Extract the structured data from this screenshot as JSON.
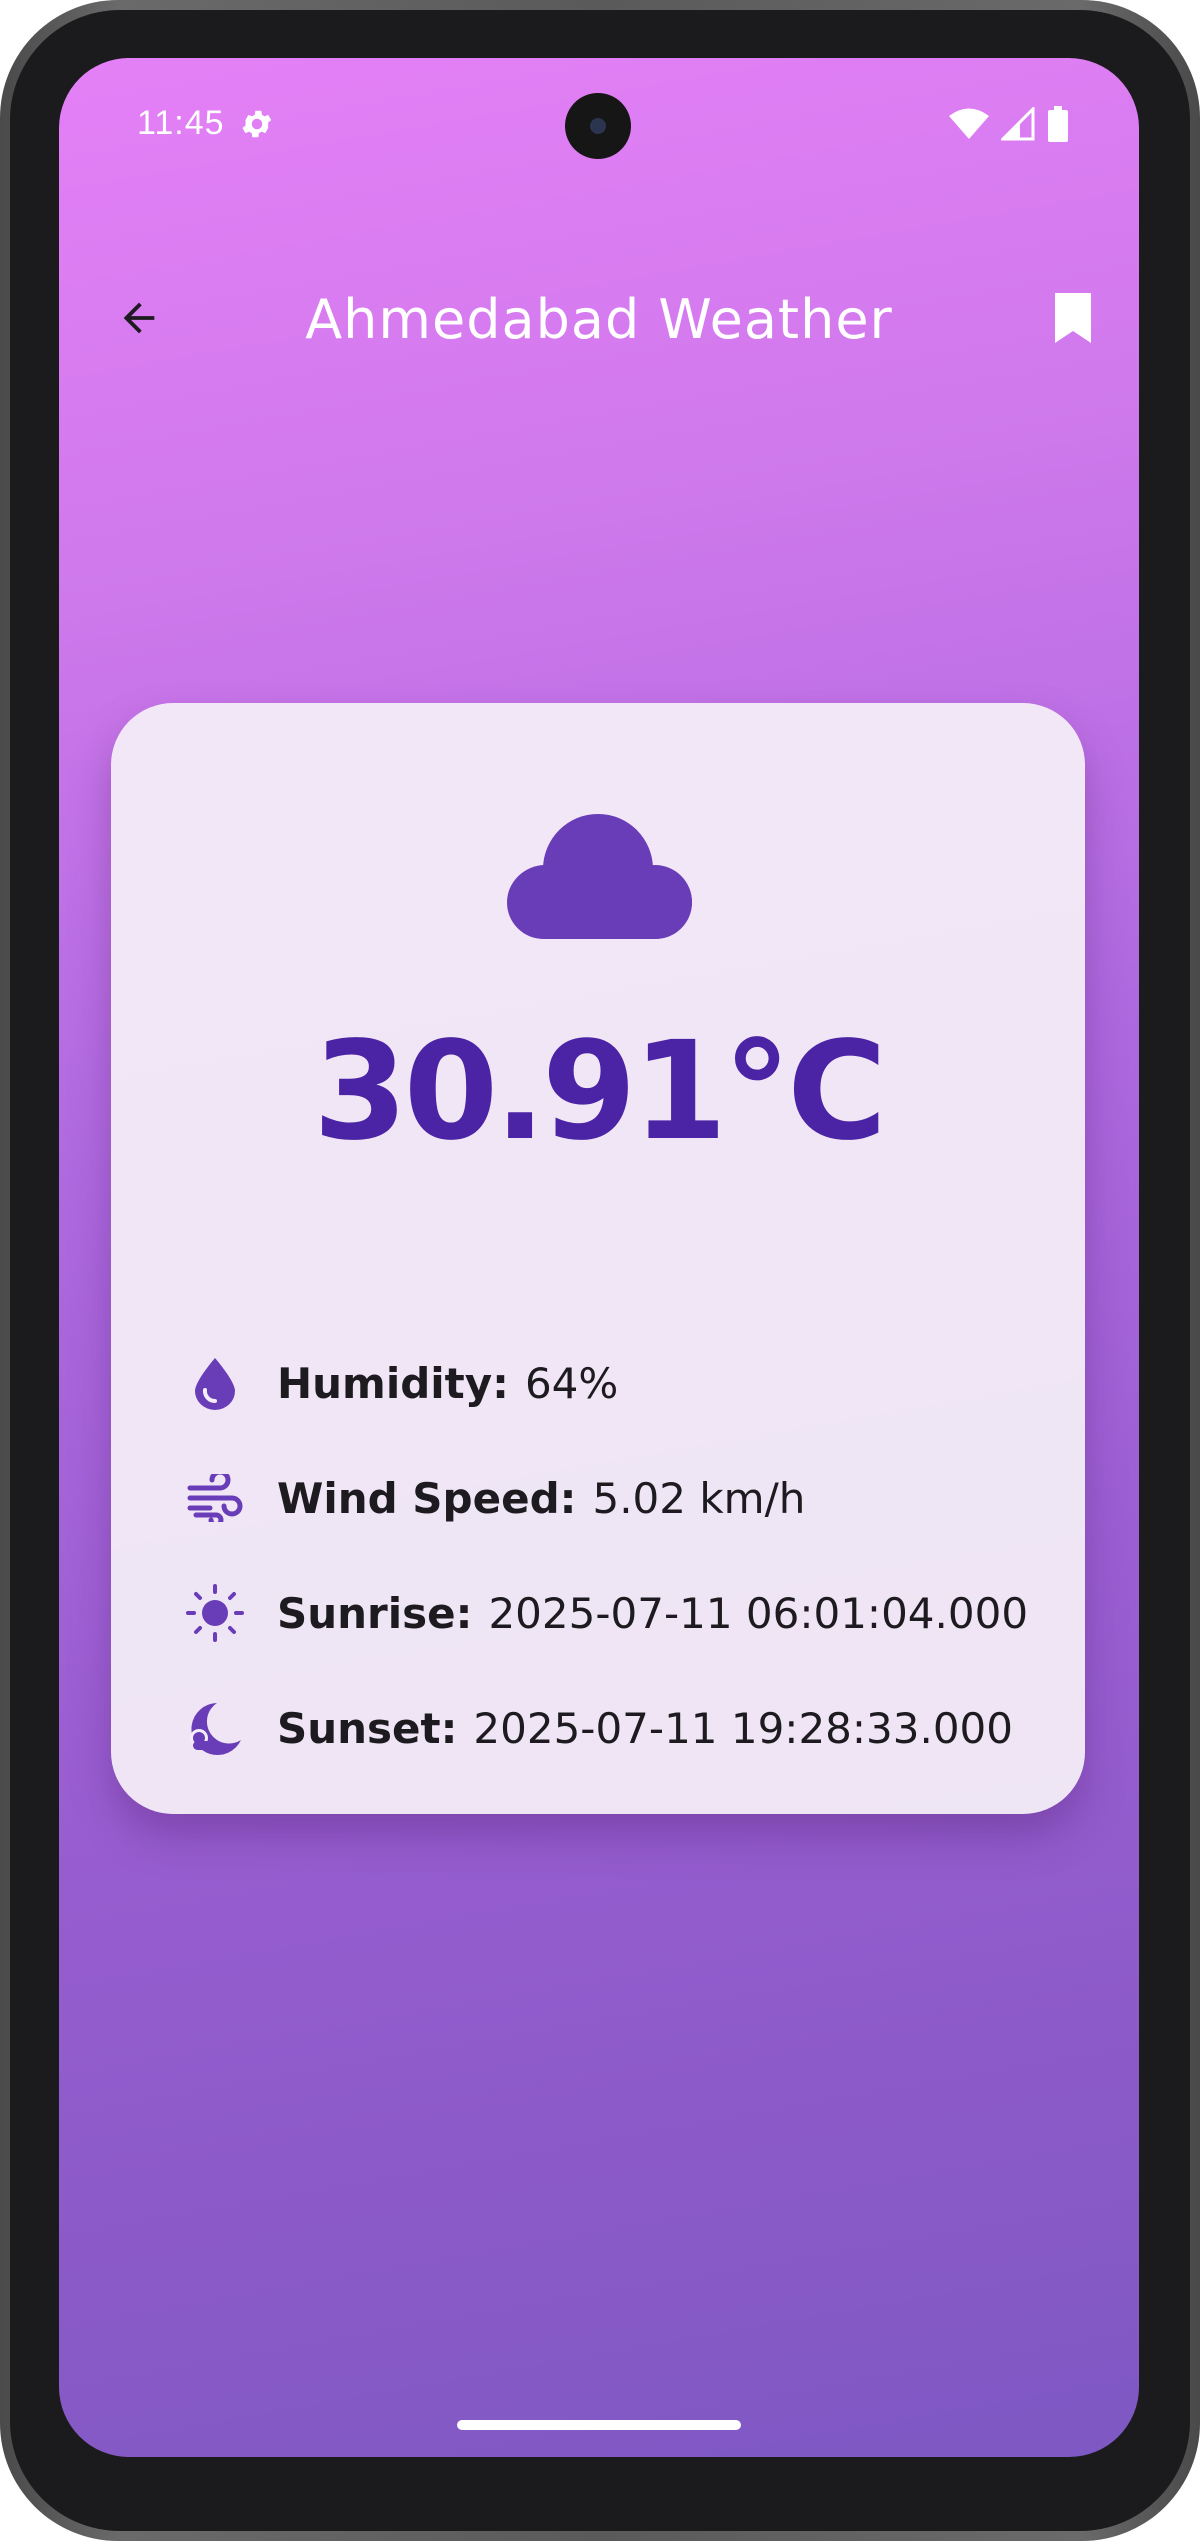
{
  "status_bar": {
    "time": "11:45",
    "icons": [
      "settings-gear-icon",
      "wifi-icon",
      "cell-signal-icon",
      "battery-icon"
    ]
  },
  "app_bar": {
    "title": "Ahmedabad Weather",
    "back_icon": "arrow-back-icon",
    "bookmark_icon": "bookmark-icon"
  },
  "weather": {
    "condition_icon": "cloud-icon",
    "temperature": "30.91°C",
    "details": {
      "humidity": {
        "label": "Humidity:",
        "value": "64%"
      },
      "wind_speed": {
        "label": "Wind Speed:",
        "value": "5.02 km/h"
      },
      "sunrise": {
        "label": "Sunrise:",
        "value": "2025-07-11 06:01:04.000"
      },
      "sunset": {
        "label": "Sunset:",
        "value": "2025-07-11 19:28:33.000"
      }
    }
  },
  "colors": {
    "accent": "#4b24a6",
    "icon": "#6a3db8",
    "gradient_top": "#e580f7",
    "gradient_bottom": "#7e58c4"
  }
}
